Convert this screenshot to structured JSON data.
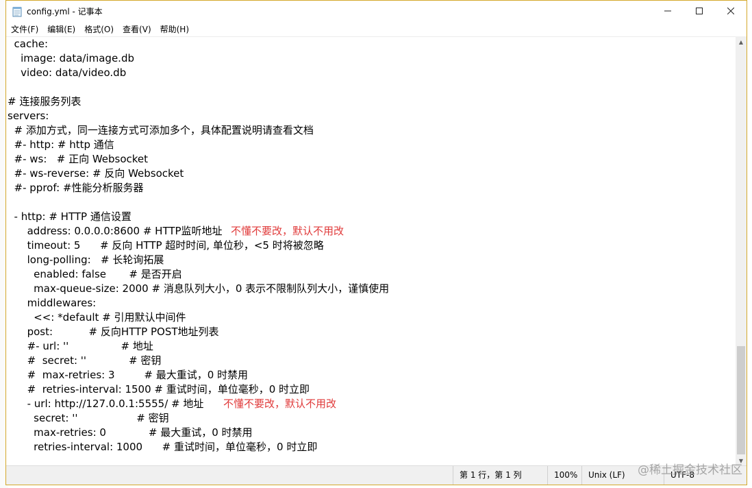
{
  "window": {
    "title": "config.yml - 记事本",
    "controls": {
      "minimize": "—",
      "maximize": "☐",
      "close": "✕"
    }
  },
  "menu": [
    "文件(F)",
    "编辑(E)",
    "格式(O)",
    "查看(V)",
    "帮助(H)"
  ],
  "editor": {
    "lines": [
      "  cache:",
      "    image: data/image.db",
      "    video: data/video.db",
      "",
      "# 连接服务列表",
      "servers:",
      "  # 添加方式，同一连接方式可添加多个，具体配置说明请查看文档",
      "  #- http: # http 通信",
      "  #- ws:   # 正向 Websocket",
      "  #- ws-reverse: # 反向 Websocket",
      "  #- pprof: #性能分析服务器",
      "",
      "  - http: # HTTP 通信设置",
      "      address: 0.0.0.0:8600 # HTTP监听地址",
      "      timeout: 5      # 反向 HTTP 超时时间, 单位秒，<5 时将被忽略",
      "      long-polling:   # 长轮询拓展",
      "        enabled: false       # 是否开启",
      "        max-queue-size: 2000 # 消息队列大小，0 表示不限制队列大小，谨慎使用",
      "      middlewares:",
      "        <<: *default # 引用默认中间件",
      "      post:           # 反向HTTP POST地址列表",
      "      #- url: ''                # 地址",
      "      #  secret: ''             # 密钥",
      "      #  max-retries: 3         # 最大重试，0 时禁用",
      "      #  retries-interval: 1500 # 重试时间，单位毫秒，0 时立即",
      "      - url: http://127.0.0.1:5555/ # 地址",
      "        secret: ''                  # 密钥",
      "        max-retries: 0             # 最大重试，0 时禁用",
      "        retries-interval: 1000      # 重试时间，单位毫秒，0 时立即"
    ],
    "annotations": [
      {
        "text": "不懂不要改，默认不用改"
      },
      {
        "text": "不懂不要改，默认不用改"
      }
    ]
  },
  "statusbar": {
    "position": "第 1 行，第 1 列",
    "zoom": "100%",
    "line_ending": "Unix (LF)",
    "encoding": "UTF-8"
  },
  "watermark": "@稀土掘金技术社区",
  "colors": {
    "annotation": "#e03a3a",
    "border": "#d4a82a"
  }
}
